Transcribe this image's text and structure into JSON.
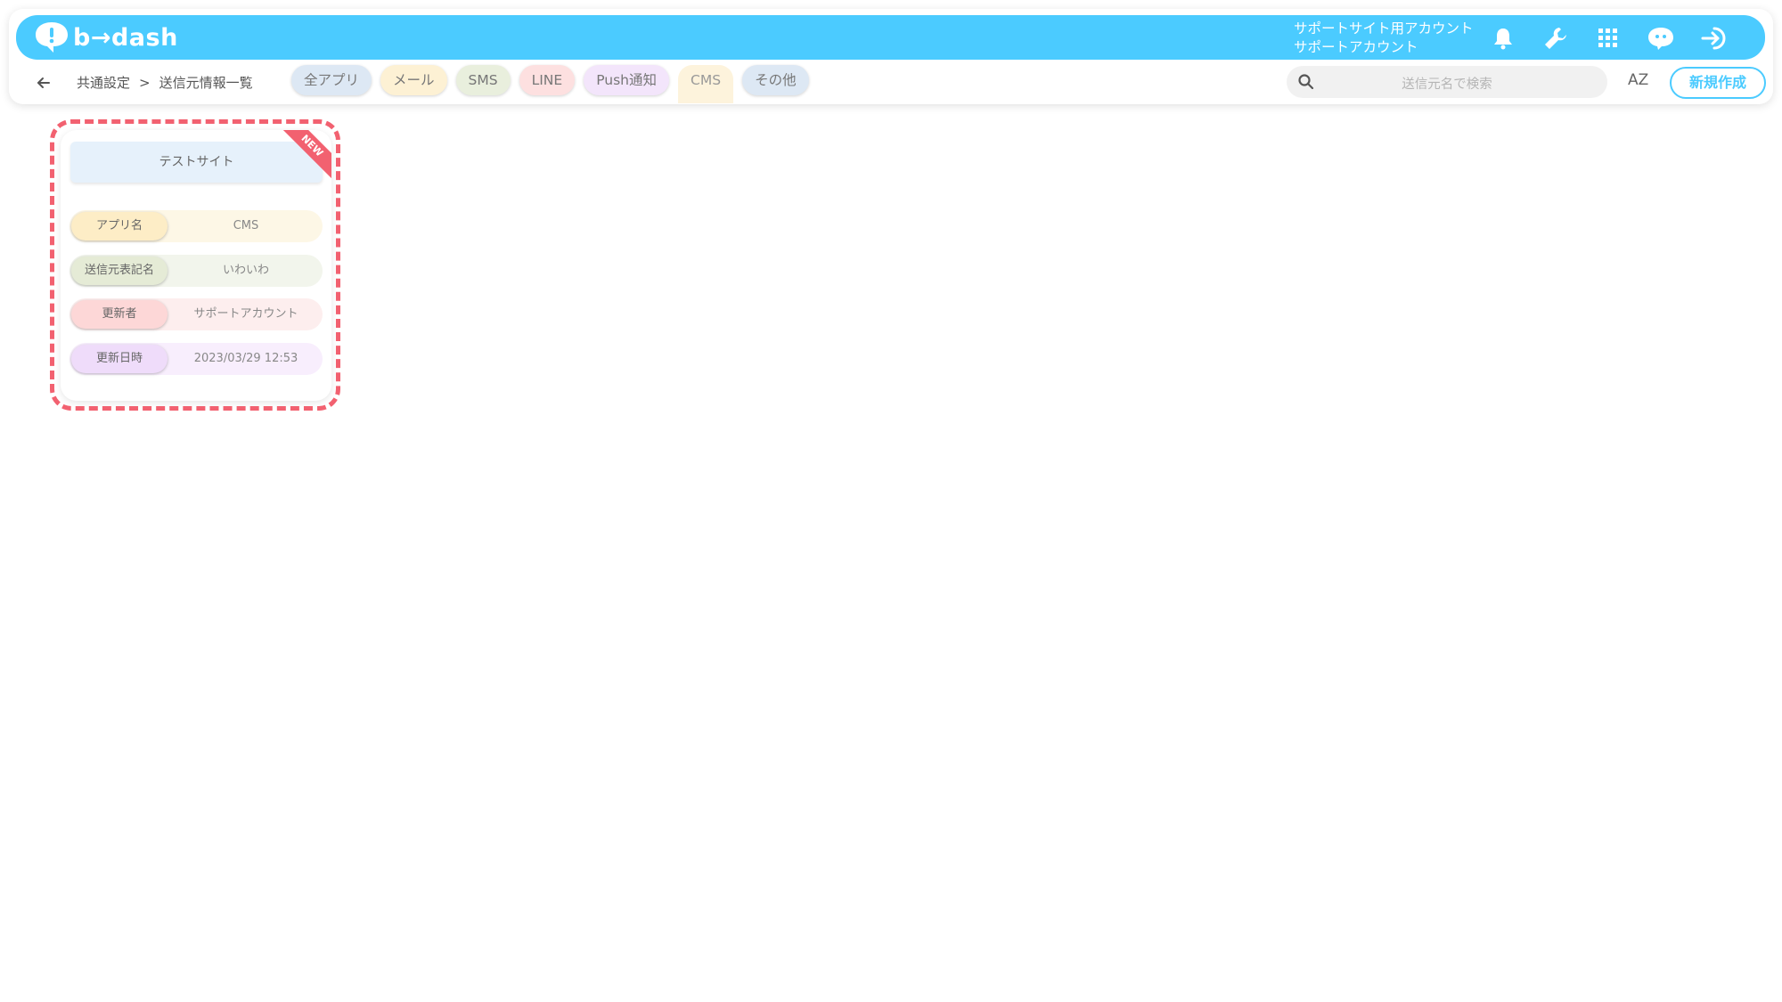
{
  "app": {
    "logo_text": "b→dash"
  },
  "header": {
    "account_line1": "サポートサイト用アカウント",
    "account_line2": "サポートアカウント",
    "icons": [
      "bell-icon",
      "wrench-icon",
      "grid-icon",
      "chat-bot-icon",
      "logout-icon"
    ],
    "accent_color": "#4bcbff"
  },
  "breadcrumb": {
    "parent": "共通設定",
    "separator": ">",
    "current": "送信元情報一覧"
  },
  "tabs": [
    {
      "label": "全アプリ",
      "color": "#dde8f4"
    },
    {
      "label": "メール",
      "color": "#fdf1d4"
    },
    {
      "label": "SMS",
      "color": "#e9efdd"
    },
    {
      "label": "LINE",
      "color": "#fde0e0"
    },
    {
      "label": "Push通知",
      "color": "#f3e5fb"
    },
    {
      "label": "CMS",
      "color": "#fdf3dc",
      "active": true
    },
    {
      "label": "その他",
      "color": "#dde8f4"
    }
  ],
  "search": {
    "placeholder": "送信元名で検索"
  },
  "sort_label": "AZ",
  "new_button": "新規作成",
  "card": {
    "title": "テストサイト",
    "badge": "NEW",
    "highlight_color": "#f26170",
    "rows": [
      {
        "label": "アプリ名",
        "value": "CMS",
        "label_bg": "#fdedc6",
        "row_bg": "#fdf7e6"
      },
      {
        "label": "送信元表記名",
        "value": "いわいわ",
        "label_bg": "#e5ebd6",
        "row_bg": "#f2f5ec"
      },
      {
        "label": "更新者",
        "value": "サポートアカウント",
        "label_bg": "#fdd7d7",
        "row_bg": "#fdeeee"
      },
      {
        "label": "更新日時",
        "value": "2023/03/29 12:53",
        "label_bg": "#efdcfa",
        "row_bg": "#f8eefd"
      }
    ]
  }
}
